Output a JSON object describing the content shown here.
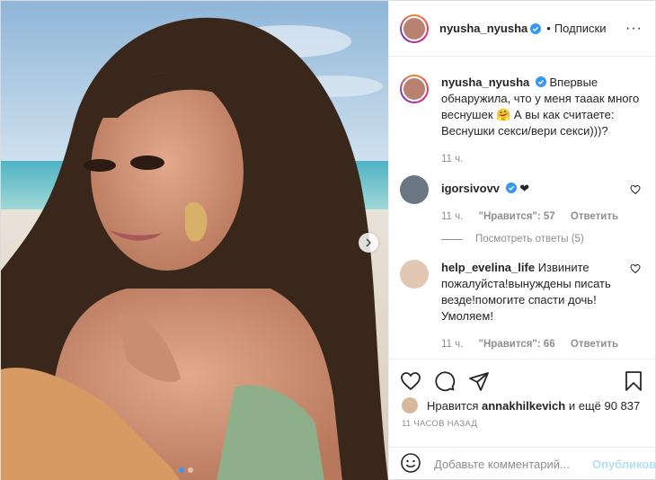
{
  "header": {
    "username": "nyusha_nyusha",
    "follow_separator": "•",
    "follow_label": "Подписки",
    "more_label": "···"
  },
  "caption": {
    "username": "nyusha_nyusha",
    "text": "Впервые обнаружила, что у меня тааак много веснушек 🤗 А вы как считаете: Веснушки секси/вери секси)))?",
    "time": "11 ч."
  },
  "comments": [
    {
      "username": "igorsivovv",
      "text": "❤",
      "time": "11 ч.",
      "likes_label": "\"Нравится\": 57",
      "reply_label": "Ответить",
      "view_replies": "Посмотреть ответы (5)"
    },
    {
      "username": "help_evelina_life",
      "text": "Извините пожалуйста!вынуждены писать везде!помогите спасти дочь! Умоляем!",
      "time": "11 ч.",
      "likes_label": "\"Нравится\": 66",
      "reply_label": "Ответить"
    }
  ],
  "likes": {
    "prefix": "Нравится",
    "user": "annakhilkevich",
    "suffix": "и ещё 90 837"
  },
  "post_time": "11 ЧАСОВ НАЗАД",
  "add_comment": {
    "placeholder": "Добавьте комментарий...",
    "post_label": "Опубликовать"
  },
  "carousel": {
    "slide_count": 2,
    "active_index": 0
  },
  "colors": {
    "link_blue": "#3897f0",
    "post_disabled": "#b2dffc",
    "muted": "#8e8e8e",
    "verified": "#3897f0"
  }
}
